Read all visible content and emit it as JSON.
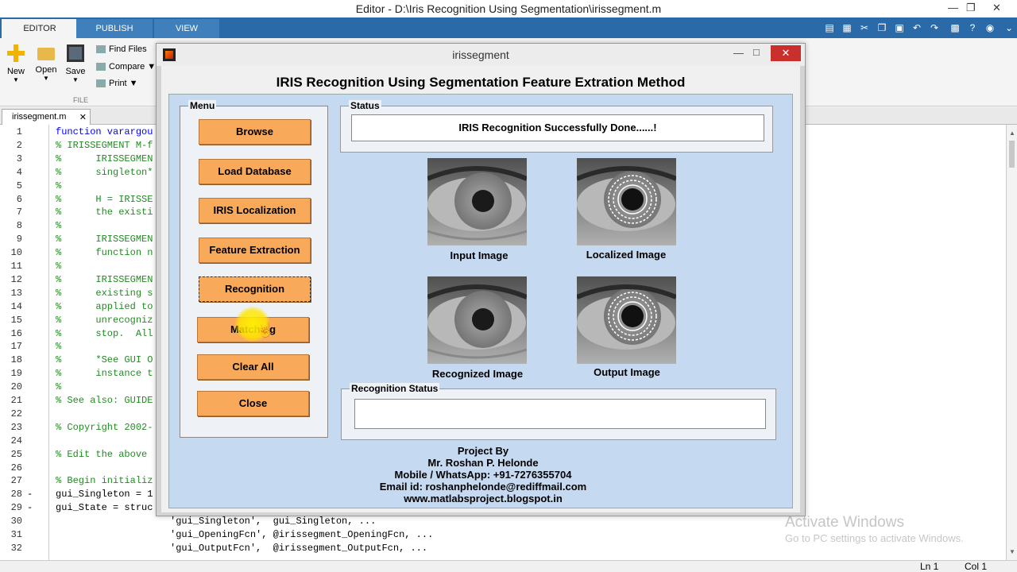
{
  "editor": {
    "title": "Editor - D:\\Iris Recognition Using Segmentation\\irissegment.m",
    "tabs": [
      "EDITOR",
      "PUBLISH",
      "VIEW"
    ],
    "ribbon": {
      "new": "New",
      "open": "Open",
      "save": "Save",
      "find_files": "Find Files",
      "compare": "Compare",
      "print": "Print",
      "section": "FILE"
    },
    "doc_tab": "irissegment.m",
    "code_lines": [
      {
        "n": "1",
        "text": "function varargou",
        "cls": "kw",
        "dash": ""
      },
      {
        "n": "2",
        "text": "% IRISSEGMENT M-f",
        "cls": "comment",
        "dash": ""
      },
      {
        "n": "3",
        "text": "%      IRISSEGMEN",
        "cls": "comment",
        "dash": ""
      },
      {
        "n": "4",
        "text": "%      singleton*",
        "cls": "comment",
        "dash": ""
      },
      {
        "n": "5",
        "text": "%",
        "cls": "comment",
        "dash": ""
      },
      {
        "n": "6",
        "text": "%      H = IRISSE",
        "cls": "comment",
        "dash": ""
      },
      {
        "n": "7",
        "text": "%      the existi",
        "cls": "comment",
        "dash": ""
      },
      {
        "n": "8",
        "text": "%",
        "cls": "comment",
        "dash": ""
      },
      {
        "n": "9",
        "text": "%      IRISSEGMEN",
        "cls": "comment",
        "dash": ""
      },
      {
        "n": "10",
        "text": "%      function n",
        "cls": "comment",
        "dash": ""
      },
      {
        "n": "11",
        "text": "%",
        "cls": "comment",
        "dash": ""
      },
      {
        "n": "12",
        "text": "%      IRISSEGMEN",
        "cls": "comment",
        "dash": ""
      },
      {
        "n": "13",
        "text": "%      existing s",
        "cls": "comment",
        "dash": ""
      },
      {
        "n": "14",
        "text": "%      applied to",
        "cls": "comment",
        "dash": ""
      },
      {
        "n": "15",
        "text": "%      unrecogniz",
        "cls": "comment",
        "dash": ""
      },
      {
        "n": "16",
        "text": "%      stop.  All",
        "cls": "comment",
        "dash": ""
      },
      {
        "n": "17",
        "text": "%",
        "cls": "comment",
        "dash": ""
      },
      {
        "n": "18",
        "text": "%      *See GUI O",
        "cls": "comment",
        "dash": ""
      },
      {
        "n": "19",
        "text": "%      instance t",
        "cls": "comment",
        "dash": ""
      },
      {
        "n": "20",
        "text": "%",
        "cls": "comment",
        "dash": ""
      },
      {
        "n": "21",
        "text": "% See also: GUIDE",
        "cls": "comment",
        "dash": ""
      },
      {
        "n": "22",
        "text": "",
        "cls": "",
        "dash": ""
      },
      {
        "n": "23",
        "text": "% Copyright 2002-",
        "cls": "comment",
        "dash": ""
      },
      {
        "n": "24",
        "text": "",
        "cls": "",
        "dash": ""
      },
      {
        "n": "25",
        "text": "% Edit the above",
        "cls": "comment",
        "dash": ""
      },
      {
        "n": "26",
        "text": "",
        "cls": "",
        "dash": ""
      },
      {
        "n": "27",
        "text": "% Begin initializ",
        "cls": "comment",
        "dash": ""
      },
      {
        "n": "28",
        "text": "gui_Singleton = 1",
        "cls": "",
        "dash": "-"
      },
      {
        "n": "29",
        "text": "gui_State = struc",
        "cls": "",
        "dash": "-"
      },
      {
        "n": "30",
        "text": "                    'gui_Singleton',  gui_Singleton, ...",
        "cls": "",
        "dash": ""
      },
      {
        "n": "31",
        "text": "                    'gui_OpeningFcn', @irissegment_OpeningFcn, ...",
        "cls": "",
        "dash": ""
      },
      {
        "n": "32",
        "text": "                    'gui_OutputFcn',  @irissegment_OutputFcn, ...",
        "cls": "",
        "dash": ""
      }
    ],
    "status": {
      "ln": "Ln  1",
      "col": "Col  1"
    }
  },
  "watermark": {
    "line1": "Activate Windows",
    "line2": "Go to PC settings to activate Windows."
  },
  "gui": {
    "window_title": "irissegment",
    "heading": "IRIS Recognition Using Segmentation Feature Extration Method",
    "menu_title": "Menu",
    "buttons": {
      "browse": "Browse",
      "load_db": "Load Database",
      "localization": "IRIS Localization",
      "feature": "Feature Extraction",
      "recognition": "Recognition",
      "matching": "Matching",
      "clear_all": "Clear All",
      "close": "Close"
    },
    "status_title": "Status",
    "status_text": "IRIS Recognition Successfully Done......!",
    "captions": {
      "input": "Input Image",
      "localized": "Localized Image",
      "recognized": "Recognized Image",
      "output": "Output Image"
    },
    "rec_status_title": "Recognition Status",
    "rec_status_text": "",
    "credits": {
      "l1": "Project By",
      "l2": "Mr. Roshan P. Helonde",
      "l3": "Mobile / WhatsApp: +91-7276355704",
      "l4": "Email id: roshanphelonde@rediffmail.com",
      "l5": "www.matlabsproject.blogspot.in"
    },
    "button_color": "#f9a95a",
    "panel_color": "#c5d9f1"
  }
}
